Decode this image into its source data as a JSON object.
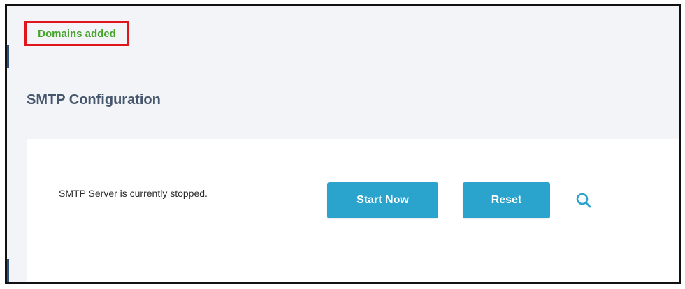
{
  "notice": {
    "text": "Domains added",
    "text_color": "#46a32b",
    "border_color": "#e0161c"
  },
  "page": {
    "title": "SMTP Configuration"
  },
  "smtp": {
    "status_text": "SMTP Server is currently stopped.",
    "start_label": "Start Now",
    "reset_label": "Reset",
    "search_icon": "search-icon"
  },
  "colors": {
    "accent": "#2aa3cd",
    "background": "#f2f4f7",
    "title": "#47566d"
  }
}
